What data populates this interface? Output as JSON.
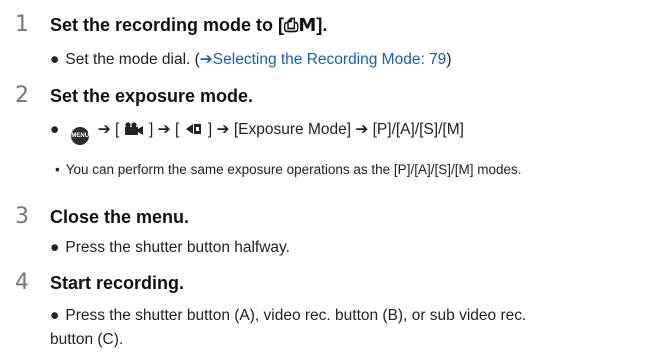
{
  "steps": [
    {
      "number": "1",
      "title_prefix": "Set the recording mode to [",
      "title_mode": "⎙M",
      "title_suffix": "].",
      "bullet": "●",
      "body_prefix": "Set the mode dial. (",
      "body_arrow": "➔",
      "body_link": "Selecting the Recording Mode: 79",
      "body_suffix": ")"
    },
    {
      "number": "2",
      "title": "Set the exposure mode.",
      "bullet": "●",
      "menu_icon_label": "MENU /SET",
      "arrow": "➔",
      "bracket_open": "[",
      "bracket_close": "]",
      "video_icon": "🎥",
      "exposure_icon": "◀▪",
      "path_tail": "[Exposure Mode] ➔ [P]/[A]/[S]/[M]",
      "note_bullet": "•",
      "note": "You can perform the same exposure operations as the [P]/[A]/[S]/[M] modes."
    },
    {
      "number": "3",
      "title": "Close the menu.",
      "bullet": "●",
      "body": "Press the shutter button halfway."
    },
    {
      "number": "4",
      "title": "Start recording.",
      "bullet": "●",
      "body_line1": "Press the shutter button (A), video rec. button (B), or sub video rec.",
      "body_line2": "button (C)."
    }
  ]
}
